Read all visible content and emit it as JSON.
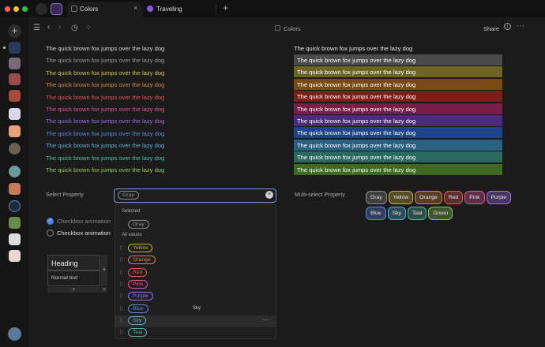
{
  "tabs": [
    {
      "label": "Colors"
    },
    {
      "label": "Traveling"
    }
  ],
  "header": {
    "title": "Colors",
    "share": "Share"
  },
  "pangram": "The quick brown fox jumps over the lazy dog",
  "text_colors": [
    "#d8d8d8",
    "#9a9a9a",
    "#d6c04a",
    "#d48a3c",
    "#e0574e",
    "#e0529c",
    "#9b6be8",
    "#5c8be0",
    "#5ab0d8",
    "#4fc0a8",
    "#8ed04a"
  ],
  "bar_colors": [
    "#4a4a4a",
    "#6e6320",
    "#7a4a16",
    "#7a2018",
    "#7a1c4a",
    "#4c2a80",
    "#1e4488",
    "#2a6080",
    "#2a6a5e",
    "#3c6a20"
  ],
  "select_property": {
    "label": "Select Property",
    "value": "Gray"
  },
  "checkboxes": [
    {
      "label": "Checkbox animation",
      "checked": true
    },
    {
      "label": "Checkbox animation",
      "checked": false
    }
  ],
  "table": {
    "heading": "Heading",
    "text": "Normal text"
  },
  "dropdown": {
    "selected_label": "Selected",
    "all_label": "All values",
    "selected": "Gray",
    "options": [
      "Yellow",
      "Orange",
      "Red",
      "Pink",
      "Purple",
      "Blue",
      "Sky",
      "Teal"
    ],
    "hover_hint": "Sky"
  },
  "multi_select": {
    "label": "Multi-select Property",
    "values": [
      "Gray",
      "Yellow",
      "Orange",
      "Red",
      "Pink",
      "Purple",
      "Blue",
      "Sky",
      "Teal",
      "Green"
    ]
  },
  "pill_colors": {
    "Gray": "#8a8a8a",
    "Yellow": "#c8b040",
    "Orange": "#d08840",
    "Red": "#e05848",
    "Pink": "#e05898",
    "Purple": "#a070e8",
    "Blue": "#5a88e0",
    "Sky": "#58a8d8",
    "Teal": "#50b8a0",
    "Green": "#88c850"
  }
}
